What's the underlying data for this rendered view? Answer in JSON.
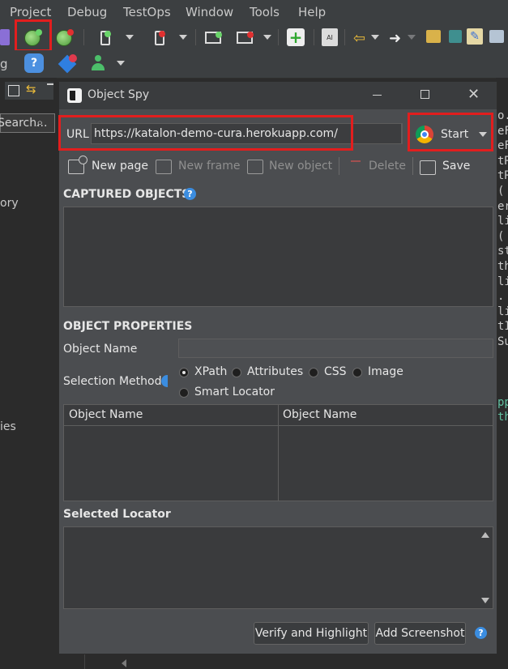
{
  "menubar": {
    "items": [
      "Project",
      "Debug",
      "TestOps",
      "Window",
      "Tools",
      "Help"
    ]
  },
  "left_panel": {
    "search_placeholder": "Search...",
    "fragment_1": "g",
    "fragment_2": "ory",
    "fragment_3": "ies"
  },
  "code_fragments": [
    "o.",
    "eF",
    "eF",
    "tR",
    "tR",
    "(",
    "er",
    "li",
    "(",
    "st",
    "th",
    "li",
    ".",
    "li",
    "tI",
    "Su",
    "pp",
    "th"
  ],
  "dialog": {
    "title": "Object Spy",
    "url_label": "URL",
    "url_value": "https://katalon-demo-cura.herokuapp.com/",
    "start_label": "Start",
    "toolbar": {
      "new_page": "New page",
      "new_frame": "New frame",
      "new_object": "New object",
      "delete": "Delete",
      "save": "Save"
    },
    "captured_objects_title": "CAPTURED OBJECTS",
    "object_properties_title": "OBJECT PROPERTIES",
    "object_name_label": "Object Name",
    "object_name_value": "",
    "selection_method_label": "Selection Method",
    "selection_methods": [
      "XPath",
      "Attributes",
      "CSS",
      "Image",
      "Smart Locator"
    ],
    "selected_method": "XPath",
    "table_headers": [
      "Object Name",
      "Object Name"
    ],
    "selected_locator_title": "Selected Locator",
    "verify_button": "Verify and Highlight",
    "screenshot_button": "Add Screenshot"
  },
  "colors": {
    "highlight": "#e21e1e",
    "dialog_bg": "#4b4d50",
    "help_blue": "#3b8de0"
  },
  "icons": [
    "katalon-logo-icon",
    "web-record-icon",
    "web-spy-icon",
    "chrome-icon",
    "help-icon",
    "minimize-icon",
    "maximize-icon",
    "close-icon"
  ]
}
